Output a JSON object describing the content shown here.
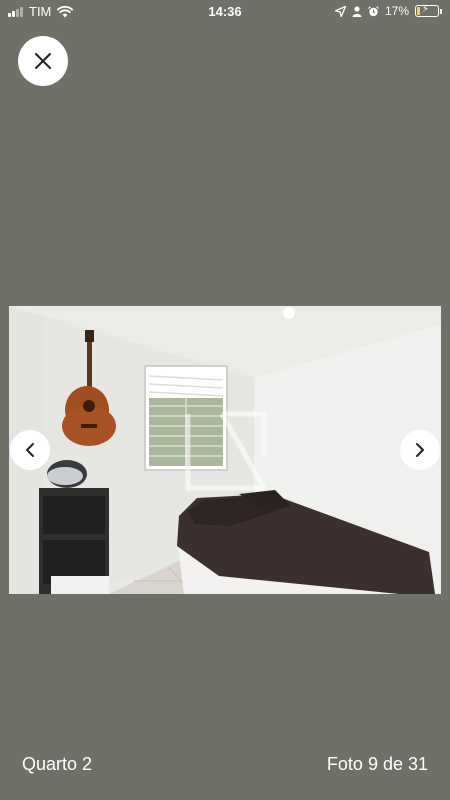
{
  "status_bar": {
    "carrier": "TIM",
    "time": "14:36",
    "battery_percent": "17%",
    "battery_level": 0.17,
    "icons": [
      "signal-icon",
      "wifi-icon",
      "location-arrow-icon",
      "person-icon",
      "alarm-icon",
      "battery-charging-icon"
    ]
  },
  "viewer": {
    "close_icon": "close-icon",
    "prev_icon": "chevron-left-icon",
    "next_icon": "chevron-right-icon",
    "caption": "Quarto 2",
    "counter": "Foto 9 de 31",
    "background_color": "#6f7068"
  }
}
